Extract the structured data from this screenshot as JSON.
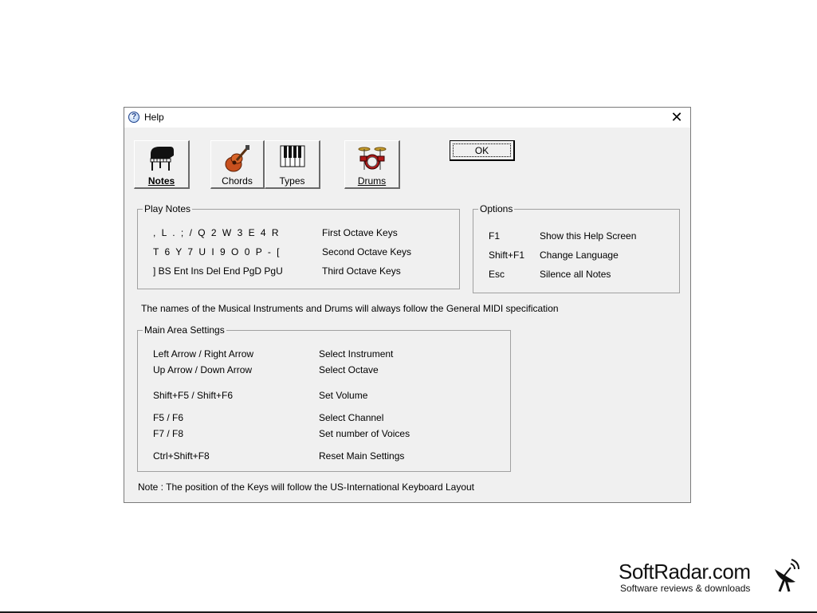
{
  "window": {
    "title": "Help",
    "close_glyph": "✕",
    "help_icon_glyph": "?"
  },
  "toolbar": {
    "notes_label": "Notes",
    "chords_label": "Chords",
    "types_label": "Types",
    "drums_label": "Drums"
  },
  "ok_label": "OK",
  "play_notes": {
    "title": "Play Notes",
    "rows": [
      {
        "keys": ", L . ; / Q 2 W 3 E 4 R",
        "desc": "First Octave Keys"
      },
      {
        "keys": "T 6 Y 7 U I 9 O 0 P - [",
        "desc": "Second Octave Keys"
      },
      {
        "keys": "] BS Ent Ins Del End PgD PgU",
        "desc": "Third Octave Keys"
      }
    ]
  },
  "options": {
    "title": "Options",
    "rows": [
      {
        "key": "F1",
        "desc": "Show this Help Screen"
      },
      {
        "key": "Shift+F1",
        "desc": "Change Language"
      },
      {
        "key": "Esc",
        "desc": "Silence all Notes"
      }
    ]
  },
  "midi_note": "The names of the Musical Instruments and Drums will always follow the General MIDI specification",
  "main_area": {
    "title": "Main Area Settings",
    "rows": [
      {
        "key": "Left Arrow / Right Arrow",
        "desc": "Select Instrument"
      },
      {
        "key": "Up Arrow / Down Arrow",
        "desc": "Select Octave"
      },
      {
        "key": "Shift+F5 / Shift+F6",
        "desc": "Set Volume"
      },
      {
        "key": "F5 / F6",
        "desc": "Select Channel"
      },
      {
        "key": "F7 / F8",
        "desc": "Set number of Voices"
      },
      {
        "key": "Ctrl+Shift+F8",
        "desc": "Reset Main Settings"
      }
    ]
  },
  "footer_note": "Note : The position of the Keys will follow the US-International Keyboard Layout",
  "watermark": {
    "brand": "SoftRadar.com",
    "tagline": "Software reviews & downloads"
  },
  "colors": {
    "dialog_bg": "#f0f0f0",
    "guitar": "#c8501e",
    "drum": "#b01818"
  }
}
